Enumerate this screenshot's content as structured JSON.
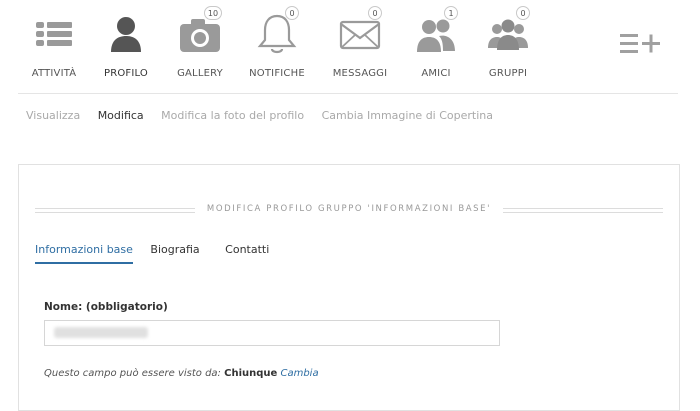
{
  "nav": {
    "items": [
      {
        "key": "activity",
        "label": "ATTIVITÀ",
        "icon": "list-icon",
        "badge": null
      },
      {
        "key": "profile",
        "label": "PROFILO",
        "icon": "user-icon",
        "badge": null
      },
      {
        "key": "gallery",
        "label": "GALLERY",
        "icon": "camera-icon",
        "badge": "10"
      },
      {
        "key": "notifications",
        "label": "NOTIFICHE",
        "icon": "bell-icon",
        "badge": "0"
      },
      {
        "key": "messages",
        "label": "MESSAGGI",
        "icon": "envelope-icon",
        "badge": "0"
      },
      {
        "key": "friends",
        "label": "AMICI",
        "icon": "friends-icon",
        "badge": "1"
      },
      {
        "key": "groups",
        "label": "GRUPPI",
        "icon": "group-icon",
        "badge": "0"
      }
    ],
    "active": "profile",
    "menu_icon": "menu-plus-icon"
  },
  "subnav": {
    "items": [
      "Visualizza",
      "Modifica",
      "Modifica la foto del profilo",
      "Cambia Immagine di Copertina"
    ],
    "active": "Modifica"
  },
  "panel": {
    "section_title": "MODIFICA PROFILO GRUPPO 'INFORMAZIONI BASE'",
    "tabs": [
      "Informazioni base",
      "Biografia",
      "Contatti"
    ],
    "active_tab": "Informazioni base",
    "field": {
      "label": "Nome: (obbligatorio)",
      "value": ""
    },
    "visibility": {
      "prefix": "Questo campo può essere visto da:",
      "who": "Chiunque",
      "change_label": "Cambia"
    }
  },
  "colors": {
    "icon_gray": "#8a8a8a",
    "active_icon": "#555555",
    "link_blue": "#2f6ea3",
    "muted_text": "#a9a9a9"
  }
}
